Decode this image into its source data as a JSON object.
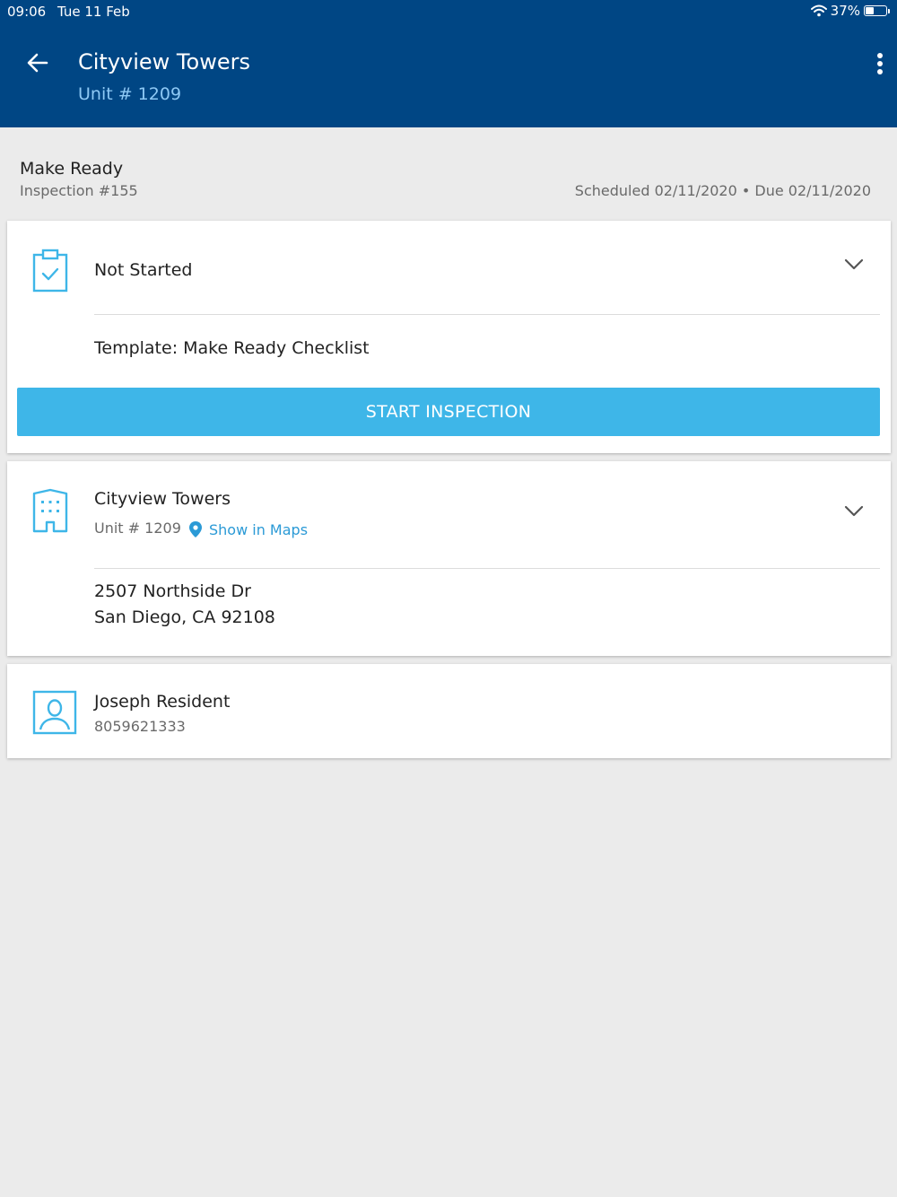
{
  "status_bar": {
    "time": "09:06",
    "date": "Tue 11 Feb",
    "battery": "37%",
    "battery_level": 0.37
  },
  "header": {
    "title": "Cityview Towers",
    "subtitle": "Unit # 1209"
  },
  "inspection": {
    "name": "Make Ready",
    "number": "Inspection #155",
    "schedule": "Scheduled 02/11/2020 • Due 02/11/2020"
  },
  "status_card": {
    "status": "Not Started",
    "template": "Template: Make Ready Checklist",
    "button_label": "START INSPECTION"
  },
  "property_card": {
    "name": "Cityview Towers",
    "unit": "Unit # 1209",
    "maps_label": "Show in Maps",
    "address_line1": "2507 Northside Dr",
    "address_line2": "San Diego, CA 92108"
  },
  "resident_card": {
    "name": "Joseph Resident",
    "phone": "8059621333"
  },
  "colors": {
    "header": "#004684",
    "accent": "#3eb6e8",
    "icon": "#3eb6e8",
    "link": "#2b9ad6"
  }
}
